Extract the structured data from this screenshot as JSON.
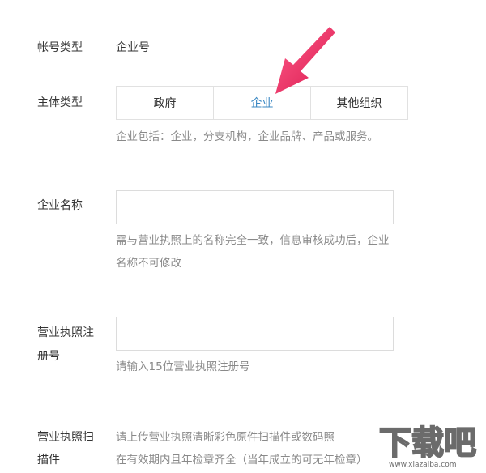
{
  "account_type": {
    "label": "帐号类型",
    "value": "企业号"
  },
  "subject_type": {
    "label": "主体类型",
    "options": [
      "政府",
      "企业",
      "其他组织"
    ],
    "selected": "企业",
    "hint": "企业包括：企业，分支机构，企业品牌、产品或服务。"
  },
  "company_name": {
    "label": "企业名称",
    "value": "",
    "hint_line1": "需与营业执照上的名称完全一致，信息审核成功后，企业",
    "hint_line2": "名称不可修改"
  },
  "license_number": {
    "label_line1": "营业执照注",
    "label_line2": "册号",
    "value": "",
    "hint": "请输入15位营业执照注册号"
  },
  "license_scan": {
    "label_line1": "营业执照扫",
    "label_line2": "描件",
    "hint_line1": "请上传营业执照清晰彩色原件扫描件或数码照",
    "hint_line2": "在有效期内且年检章齐全（当年成立的可无年检章）"
  },
  "watermark": {
    "text": "下载吧",
    "url_text": "www.xiazaiba.com"
  },
  "colors": {
    "accent": "#3b88c3",
    "arrow": "#e8245a",
    "hint": "#8a8a8a"
  },
  "icons": {
    "arrow": "arrow-pointer-icon"
  }
}
